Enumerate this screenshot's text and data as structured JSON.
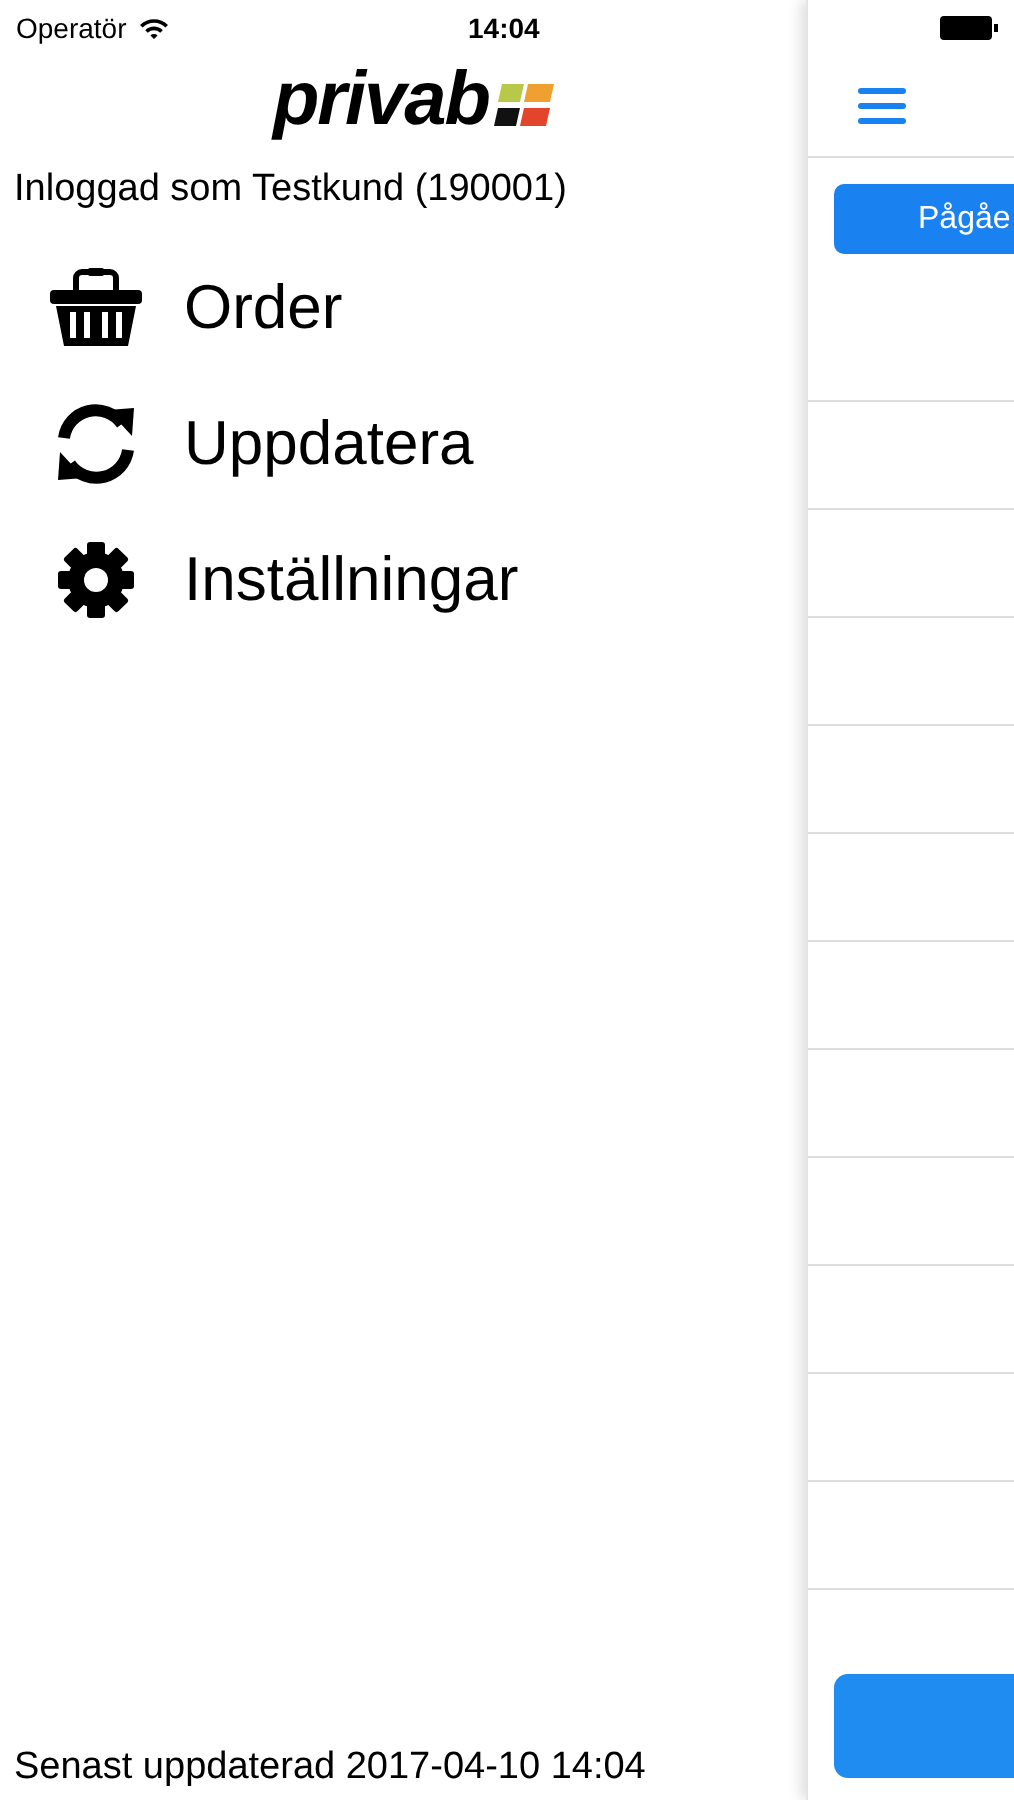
{
  "status_bar": {
    "carrier": "Operatör",
    "time": "14:04"
  },
  "logo": {
    "text": "privab"
  },
  "user_label": "Inloggad som Testkund (190001)",
  "menu": [
    {
      "kind": "basket",
      "label": "Order"
    },
    {
      "kind": "refresh",
      "label": "Uppdatera"
    },
    {
      "kind": "gear",
      "label": "Inställningar"
    }
  ],
  "last_updated": "Senast uppdaterad 2017-04-10 14:04",
  "main_panel": {
    "filter_button": "Pågåe"
  }
}
